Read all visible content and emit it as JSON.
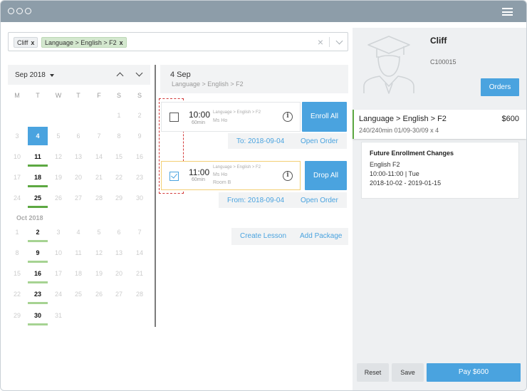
{
  "window": {
    "menu_icon": "hamburger-icon"
  },
  "search": {
    "chips": [
      {
        "label": "Cliff",
        "remove": "x"
      },
      {
        "label": "Language > English > F2",
        "remove": "x"
      }
    ],
    "clear_icon": "×"
  },
  "calendar": {
    "month_label": "Sep 2018",
    "weekdays": [
      "M",
      "T",
      "W",
      "T",
      "F",
      "S",
      "S"
    ],
    "second_month_label": "Oct 2018",
    "days": {
      "d1": "1",
      "d2": "2",
      "d3": "3",
      "d4": "4",
      "d5": "5",
      "d6": "6",
      "d7": "7",
      "d8": "8",
      "d9": "9",
      "d10": "10",
      "d11": "11",
      "d12": "12",
      "d13": "13",
      "d14": "14",
      "d15": "15",
      "d16": "16",
      "d17": "17",
      "d18": "18",
      "d19": "19",
      "d20": "20",
      "d21": "21",
      "d22": "22",
      "d23": "23",
      "d24": "24",
      "d25": "25",
      "d26": "26",
      "d27": "27",
      "d28": "28",
      "d29": "29",
      "d30": "30",
      "o1": "1",
      "o2": "2",
      "o3": "3",
      "o4": "4",
      "o5": "5",
      "o6": "6",
      "o7": "7",
      "o8": "8",
      "o9": "9",
      "o10": "10",
      "o11": "11",
      "o12": "12",
      "o13": "13",
      "o14": "14",
      "o15": "15",
      "o16": "16",
      "o17": "17",
      "o18": "18",
      "o19": "19",
      "o20": "20",
      "o21": "21",
      "o22": "22",
      "o23": "23",
      "o24": "24",
      "o25": "25",
      "o26": "26",
      "o27": "27",
      "o28": "28",
      "o29": "29",
      "o30": "30",
      "o31": "31"
    }
  },
  "schedule": {
    "date_title": "4 Sep",
    "course_path": "Language > English > F2",
    "lessons": [
      {
        "time": "10:00",
        "duration": "60min",
        "course": "Language > English > F2",
        "teacher": "Ms Ho",
        "room": "",
        "checked": false,
        "action": "Enroll All",
        "date_link": "To: 2018-09-04",
        "order_link": "Open Order"
      },
      {
        "time": "11:00",
        "duration": "60min",
        "course": "Language > English > F2",
        "teacher": "Ms Ho",
        "room": "Room B",
        "checked": true,
        "action": "Drop All",
        "date_link": "From: 2018-09-04",
        "order_link": "Open Order"
      }
    ],
    "create_lesson": "Create Lesson",
    "add_package": "Add Package"
  },
  "student": {
    "name": "Cliff",
    "id": "C100015",
    "orders_button": "Orders",
    "package": {
      "name": "Language > English > F2",
      "price": "$600",
      "meta": "240/240min 01/09-30/09 x 4"
    },
    "future": {
      "title": "Future Enrollment Changes",
      "course": "English F2",
      "slot": "10:00-11:00 | Tue",
      "range": "2018-10-02 - 2019-01-15"
    }
  },
  "footer": {
    "reset": "Reset",
    "save": "Save",
    "pay": "Pay $600"
  },
  "colors": {
    "accent": "#4aa3df",
    "titlebar": "#8d9da9",
    "enrolled": "#5da842",
    "enrolled_light": "#a6d392",
    "selected_border": "#f3cf73",
    "highlight": "#d33a3a"
  }
}
